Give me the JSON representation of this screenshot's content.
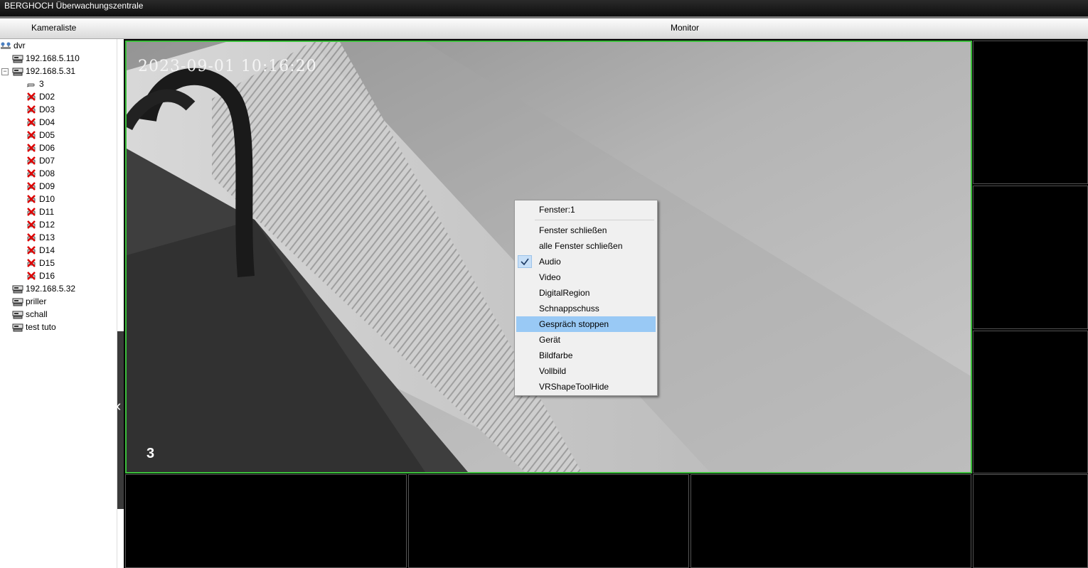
{
  "window": {
    "title": "BERGHOCH Überwachungszentrale"
  },
  "header": {
    "camera_list_label": "Kameraliste",
    "monitor_label": "Monitor"
  },
  "tree": {
    "root": "dvr",
    "dev1": "192.168.5.110",
    "dev2": "192.168.5.31",
    "dev2_children": [
      "3",
      "D02",
      "D03",
      "D04",
      "D05",
      "D06",
      "D07",
      "D08",
      "D09",
      "D10",
      "D11",
      "D12",
      "D13",
      "D14",
      "D15",
      "D16"
    ],
    "dev3": "192.168.5.32",
    "dev4": "priller",
    "dev5": "schall",
    "dev6": "test tuto",
    "expander_symbol": "−"
  },
  "video": {
    "timestamp": "2023-09-01  10:16:20",
    "channel": "3"
  },
  "context_menu": {
    "header": "Fenster:1",
    "items": [
      "Fenster schließen",
      "alle Fenster schließen",
      "Audio",
      "Video",
      "DigitalRegion",
      "Schnappschuss",
      "Gespräch stoppen",
      "Gerät",
      "Bildfarbe",
      "Vollbild",
      "VRShapeToolHide"
    ],
    "checked": "Audio",
    "highlighted": "Gespräch stoppen"
  },
  "colors": {
    "active_border": "#3cbf3c",
    "highlight": "#99c9f5"
  }
}
